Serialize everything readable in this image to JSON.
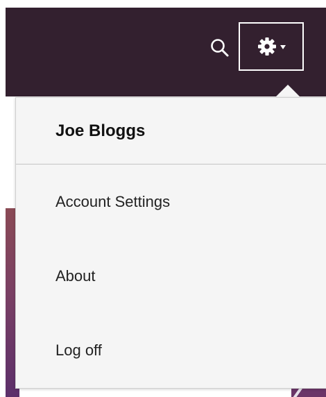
{
  "header": {
    "search_icon": "search-icon",
    "settings_icon": "gear-icon",
    "caret_icon": "caret-down-icon",
    "bar_color": "#33202f"
  },
  "menu": {
    "user_name": "Joe Bloggs",
    "items": [
      {
        "label": "Account Settings"
      },
      {
        "label": "About"
      },
      {
        "label": "Log off"
      }
    ]
  }
}
